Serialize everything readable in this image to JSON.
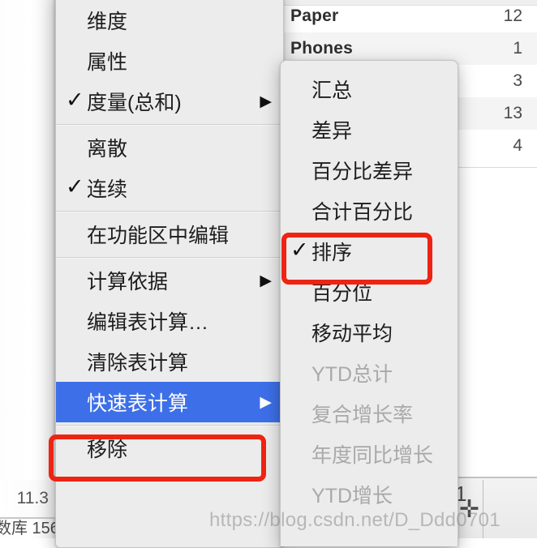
{
  "worksheet": {
    "table_rows": [
      {
        "label": "Paper",
        "value": "12"
      },
      {
        "label": "Phones",
        "value": "1"
      },
      {
        "label": "",
        "value": "3"
      },
      {
        "label": "",
        "value": "13"
      },
      {
        "label": "",
        "value": "4"
      }
    ],
    "bottom_left_value": "11.3",
    "bottom_left_clipped": "数库 156",
    "bottom_right_digit": "1",
    "bottom_right_icon": "plus-icon"
  },
  "main_menu": {
    "groups": [
      {
        "items": [
          {
            "label": "维度",
            "checked": false,
            "submenu": false,
            "disabled": false,
            "selected": false
          },
          {
            "label": "属性",
            "checked": false,
            "submenu": false,
            "disabled": false,
            "selected": false
          },
          {
            "label": "度量(总和)",
            "checked": true,
            "submenu": true,
            "disabled": false,
            "selected": false
          }
        ]
      },
      {
        "items": [
          {
            "label": "离散",
            "checked": false,
            "submenu": false,
            "disabled": false,
            "selected": false
          },
          {
            "label": "连续",
            "checked": true,
            "submenu": false,
            "disabled": false,
            "selected": false
          }
        ]
      },
      {
        "items": [
          {
            "label": "在功能区中编辑",
            "checked": false,
            "submenu": false,
            "disabled": false,
            "selected": false
          }
        ]
      },
      {
        "items": [
          {
            "label": "计算依据",
            "checked": false,
            "submenu": true,
            "disabled": false,
            "selected": false
          },
          {
            "label": "编辑表计算…",
            "checked": false,
            "submenu": false,
            "disabled": false,
            "selected": false
          },
          {
            "label": "清除表计算",
            "checked": false,
            "submenu": false,
            "disabled": false,
            "selected": false
          },
          {
            "label": "快速表计算",
            "checked": false,
            "submenu": true,
            "disabled": false,
            "selected": true
          }
        ]
      },
      {
        "items": [
          {
            "label": "移除",
            "checked": false,
            "submenu": false,
            "disabled": false,
            "selected": false
          }
        ]
      }
    ]
  },
  "sub_menu": {
    "items": [
      {
        "label": "汇总",
        "checked": false,
        "disabled": false
      },
      {
        "label": "差异",
        "checked": false,
        "disabled": false
      },
      {
        "label": "百分比差异",
        "checked": false,
        "disabled": false
      },
      {
        "label": "合计百分比",
        "checked": false,
        "disabled": false
      },
      {
        "label": "排序",
        "checked": true,
        "disabled": false
      },
      {
        "label": "百分位",
        "checked": false,
        "disabled": false
      },
      {
        "label": "移动平均",
        "checked": false,
        "disabled": false
      },
      {
        "label": "YTD总计",
        "checked": false,
        "disabled": true
      },
      {
        "label": "复合增长率",
        "checked": false,
        "disabled": true
      },
      {
        "label": "年度同比增长",
        "checked": false,
        "disabled": true
      },
      {
        "label": "YTD增长",
        "checked": false,
        "disabled": true
      }
    ]
  },
  "annotations": {
    "highlight_quick_table_calc": "快速表计算",
    "highlight_rank": "排序",
    "highlight_color": "#ee2312",
    "selection_color": "#3d6fe8"
  },
  "watermark": {
    "text": "https://blog.csdn.net/D_Ddd0701"
  },
  "icons": {
    "check": "✓",
    "submenu_arrow": "▶",
    "plus": "✛"
  }
}
